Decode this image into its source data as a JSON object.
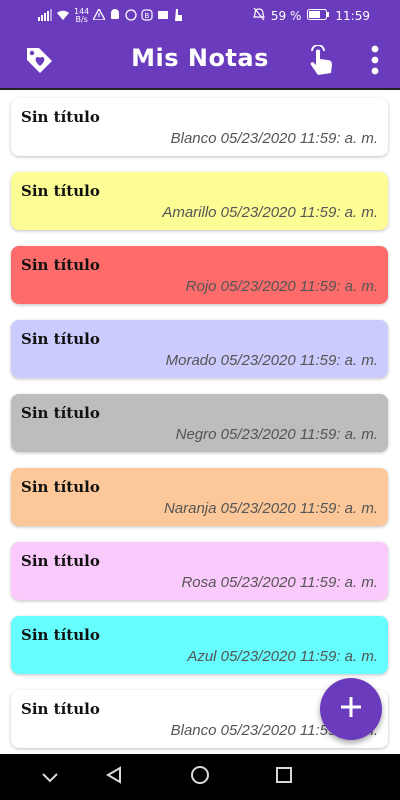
{
  "status": {
    "network_speed_value": "144",
    "network_speed_unit": "B/s",
    "battery": "59 %",
    "time": "11:59"
  },
  "app_bar": {
    "title": "Mis Notas",
    "left_icon": "tag-heart-icon",
    "right_icons": [
      "touch-hand-icon",
      "more-vert-icon"
    ]
  },
  "notes": [
    {
      "title": "Sin título",
      "meta": "Blanco 05/23/2020 11:59: a. m.",
      "color": "#ffffff"
    },
    {
      "title": "Sin título",
      "meta": "Amarillo 05/23/2020 11:59: a. m.",
      "color": "#fdfd96"
    },
    {
      "title": "Sin título",
      "meta": "Rojo 05/23/2020 11:59: a. m.",
      "color": "#fe6b6b"
    },
    {
      "title": "Sin título",
      "meta": "Morado 05/23/2020 11:59: a. m.",
      "color": "#cbcbfd"
    },
    {
      "title": "Sin título",
      "meta": "Negro 05/23/2020 11:59: a. m.",
      "color": "#bdbdbd"
    },
    {
      "title": "Sin título",
      "meta": "Naranja 05/23/2020 11:59: a. m.",
      "color": "#fcc899"
    },
    {
      "title": "Sin título",
      "meta": "Rosa 05/23/2020 11:59: a. m.",
      "color": "#fbcafc"
    },
    {
      "title": "Sin título",
      "meta": "Azul 05/23/2020 11:59: a. m.",
      "color": "#65fdfd"
    },
    {
      "title": "Sin título",
      "meta": "Blanco 05/23/2020 11:59: a. m.",
      "color": "#ffffff"
    }
  ],
  "fab": {
    "icon": "plus-icon"
  },
  "colors": {
    "primary": "#6a3bbd",
    "nav_bar": "#000000"
  }
}
